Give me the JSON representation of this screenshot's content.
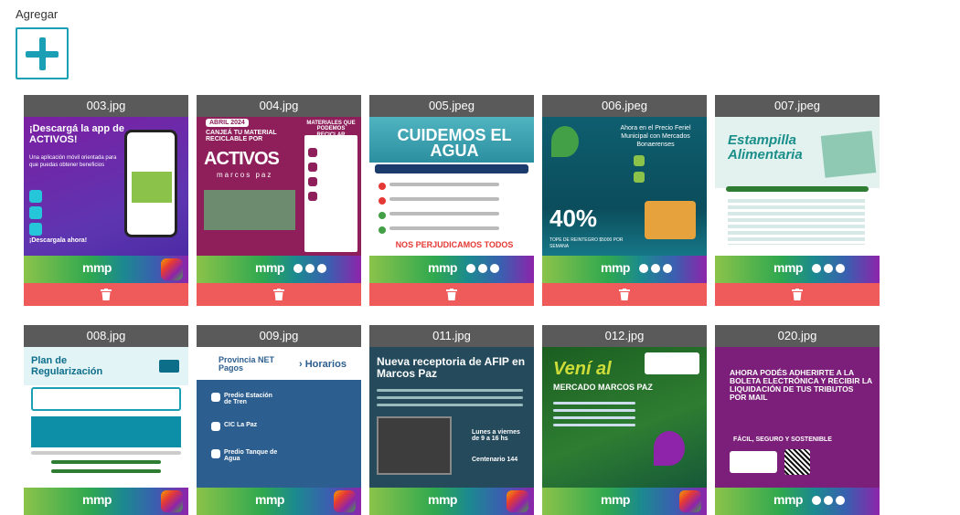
{
  "header": {
    "add_label": "Agregar"
  },
  "files": [
    {
      "name": "003.jpg",
      "title": "¡Descargá la app de ACTIVOS!",
      "cta": "¡Descargala ahora!",
      "brand": "mmp"
    },
    {
      "name": "004.jpg",
      "tag": "ABRIL 2024",
      "title": "CANJEÁ TU MATERIAL RECICLABLE POR",
      "logo": "ACTIVOS",
      "sub": "marcos paz",
      "side": "MATERIALES QUE PODEMOS RECICLAR",
      "brand": "mmp"
    },
    {
      "name": "005.jpeg",
      "title": "CUIDEMOS EL AGUA",
      "alert": "NOS PERJUDICAMOS TODOS",
      "brand": "mmp"
    },
    {
      "name": "006.jpeg",
      "title": "Ahora en el Precio Feriel Municipal con Mercados Bonaerenses",
      "pct": "40%",
      "tope": "TOPE DE REINTEGRO $5000 POR SEMANA",
      "brand": "mmp"
    },
    {
      "name": "007.jpeg",
      "title": "Estampilla Alimentaria",
      "brand": "mmp"
    },
    {
      "name": "008.jpg",
      "title": "Plan de Regularización",
      "brand": "mmp"
    },
    {
      "name": "009.jpg",
      "title": "Provincia NET Pagos",
      "horarios": "› Horarios",
      "items": [
        "Predio Estación de Tren",
        "CIC La Paz",
        "Predio Tanque de Agua"
      ],
      "brand": "mmp"
    },
    {
      "name": "011.jpg",
      "title": "Nueva receptoria de AFIP en Marcos Paz",
      "hours": "Lunes a viernes de 9 a 16 hs",
      "addr": "Centenario 144",
      "brand": "mmp"
    },
    {
      "name": "012.jpg",
      "title": "Vení al",
      "sub": "MERCADO MARCOS PAZ",
      "brand": "mmp"
    },
    {
      "name": "020.jpg",
      "title": "AHORA PODÉS ADHERIRTE A LA BOLETA ELECTRÓNICA Y RECIBIR LA LIQUIDACIÓN DE TUS TRIBUTOS POR MAIL",
      "sub": "FÁCIL, SEGURO Y SOSTENIBLE",
      "brand": "mmp"
    }
  ],
  "colors": {
    "accent": "#1a9fb5",
    "delete": "#ef5b5b",
    "header_bg": "#5a5a5a"
  },
  "icons": {
    "add": "plus-icon",
    "delete": "trash-icon"
  }
}
